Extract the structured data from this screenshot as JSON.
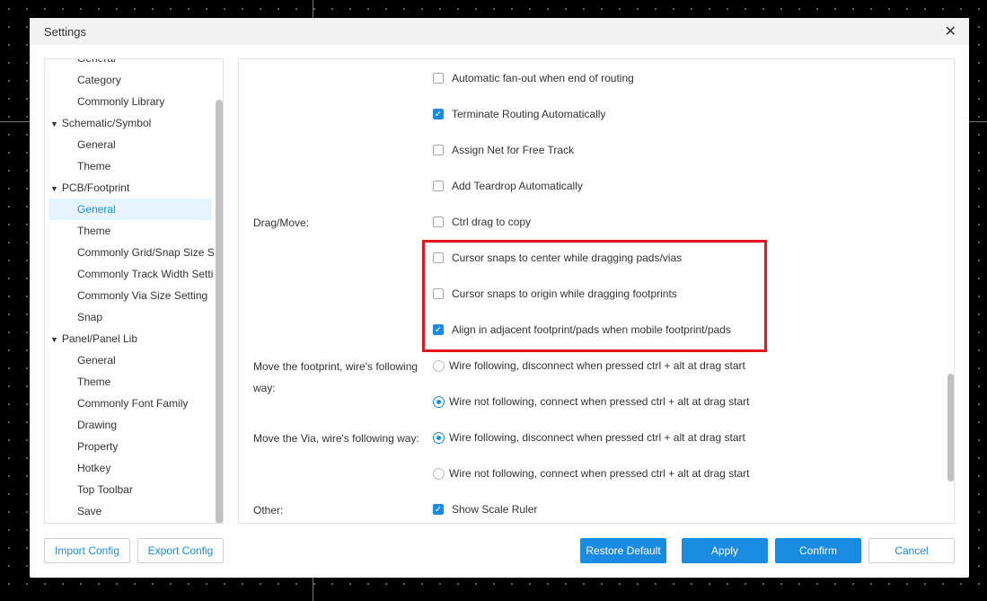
{
  "title": "Settings",
  "tree": [
    {
      "label": "General",
      "level": 2
    },
    {
      "label": "Category",
      "level": 2
    },
    {
      "label": "Commonly Library",
      "level": 2
    },
    {
      "label": "Schematic/Symbol",
      "level": 0,
      "expanded": true
    },
    {
      "label": "General",
      "level": 2
    },
    {
      "label": "Theme",
      "level": 2
    },
    {
      "label": "PCB/Footprint",
      "level": 0,
      "expanded": true
    },
    {
      "label": "General",
      "level": 2,
      "selected": true
    },
    {
      "label": "Theme",
      "level": 2
    },
    {
      "label": "Commonly Grid/Snap Size Setting",
      "level": 2
    },
    {
      "label": "Commonly Track Width Setting",
      "level": 2
    },
    {
      "label": "Commonly Via Size Setting",
      "level": 2
    },
    {
      "label": "Snap",
      "level": 2
    },
    {
      "label": "Panel/Panel Lib",
      "level": 0,
      "expanded": true
    },
    {
      "label": "General",
      "level": 2
    },
    {
      "label": "Theme",
      "level": 2
    },
    {
      "label": "Commonly Font Family",
      "level": 1
    },
    {
      "label": "Drawing",
      "level": 1
    },
    {
      "label": "Property",
      "level": 1
    },
    {
      "label": "Hotkey",
      "level": 1
    },
    {
      "label": "Top Toolbar",
      "level": 1
    },
    {
      "label": "Save",
      "level": 1
    }
  ],
  "rows": [
    {
      "label": "",
      "type": "checkbox",
      "text": "Automatic fan-out when end of routing",
      "checked": false
    },
    {
      "label": "",
      "type": "checkbox",
      "text": "Terminate Routing Automatically",
      "checked": true
    },
    {
      "label": "",
      "type": "checkbox",
      "text": "Assign Net for Free Track",
      "checked": false
    },
    {
      "label": "",
      "type": "checkbox",
      "text": "Add Teardrop Automatically",
      "checked": false
    },
    {
      "label": "Drag/Move:",
      "type": "checkbox",
      "text": "Ctrl drag to copy",
      "checked": false
    },
    {
      "label": "",
      "type": "checkbox",
      "text": "Cursor snaps to center while dragging pads/vias",
      "checked": false
    },
    {
      "label": "",
      "type": "checkbox",
      "text": "Cursor snaps to origin while dragging footprints",
      "checked": false
    },
    {
      "label": "",
      "type": "checkbox",
      "text": "Align in adjacent footprint/pads when mobile footprint/pads",
      "checked": true
    },
    {
      "label": "Move the footprint, wire's following way:",
      "type": "radio",
      "text": "Wire following, disconnect when pressed ctrl + alt at drag start",
      "checked": false
    },
    {
      "label": "",
      "type": "radio",
      "text": "Wire not following, connect when pressed ctrl + alt at drag start",
      "checked": true
    },
    {
      "label": "Move the Via, wire's following way:",
      "type": "radio",
      "text": "Wire following, disconnect when pressed ctrl + alt at drag start",
      "checked": true
    },
    {
      "label": "",
      "type": "radio",
      "text": "Wire not following, connect when pressed ctrl + alt at drag start",
      "checked": false
    },
    {
      "label": "Other:",
      "type": "checkbox",
      "text": "Show Scale Ruler",
      "checked": true
    }
  ],
  "buttons": {
    "import": "Import Config",
    "export": "Export Config",
    "restore": "Restore Default",
    "apply": "Apply",
    "confirm": "Confirm",
    "cancel": "Cancel"
  },
  "colors": {
    "accent": "#1a8be0",
    "highlight": "#e3141c"
  }
}
